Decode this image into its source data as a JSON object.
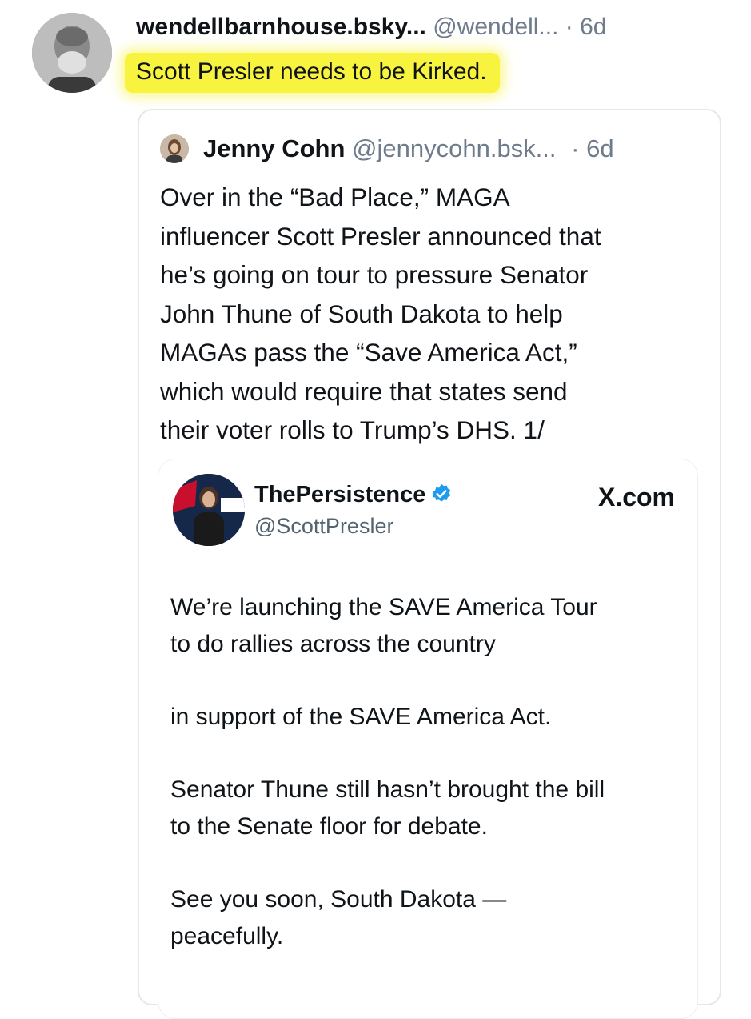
{
  "post": {
    "display_name": "wendellbarnhouse.bsky...",
    "handle": "@wendell...",
    "separator": "·",
    "age": "6d",
    "text": "Scott Presler needs to be Kirked.",
    "highlight_color": "#f8f33f"
  },
  "quoted": {
    "display_name": "Jenny Cohn",
    "handle": "@jennycohn.bsk...",
    "separator": "·",
    "age": "6d",
    "text": "Over in the “Bad Place,” MAGA\ninfluencer Scott Presler announced that\nhe’s going on tour to pressure Senator\nJohn Thune of South Dakota to help\nMAGAs pass the “Save America Act,”\nwhich would require that states send\ntheir voter rolls to Trump’s DHS. 1/"
  },
  "embedded_x_post": {
    "display_name": "ThePersistence",
    "handle": "@ScottPresler",
    "brand": "X.com",
    "verified_color": "#1d9bf0",
    "paragraphs": [
      "We’re launching the SAVE America Tour\nto do rallies across the country",
      "in support of the SAVE America Act.",
      "Senator Thune still hasn’t brought the bill\nto the Senate floor for debate.",
      "See you soon, South Dakota —\npeacefully."
    ]
  },
  "icons": {
    "verified": "verified-badge-icon"
  }
}
